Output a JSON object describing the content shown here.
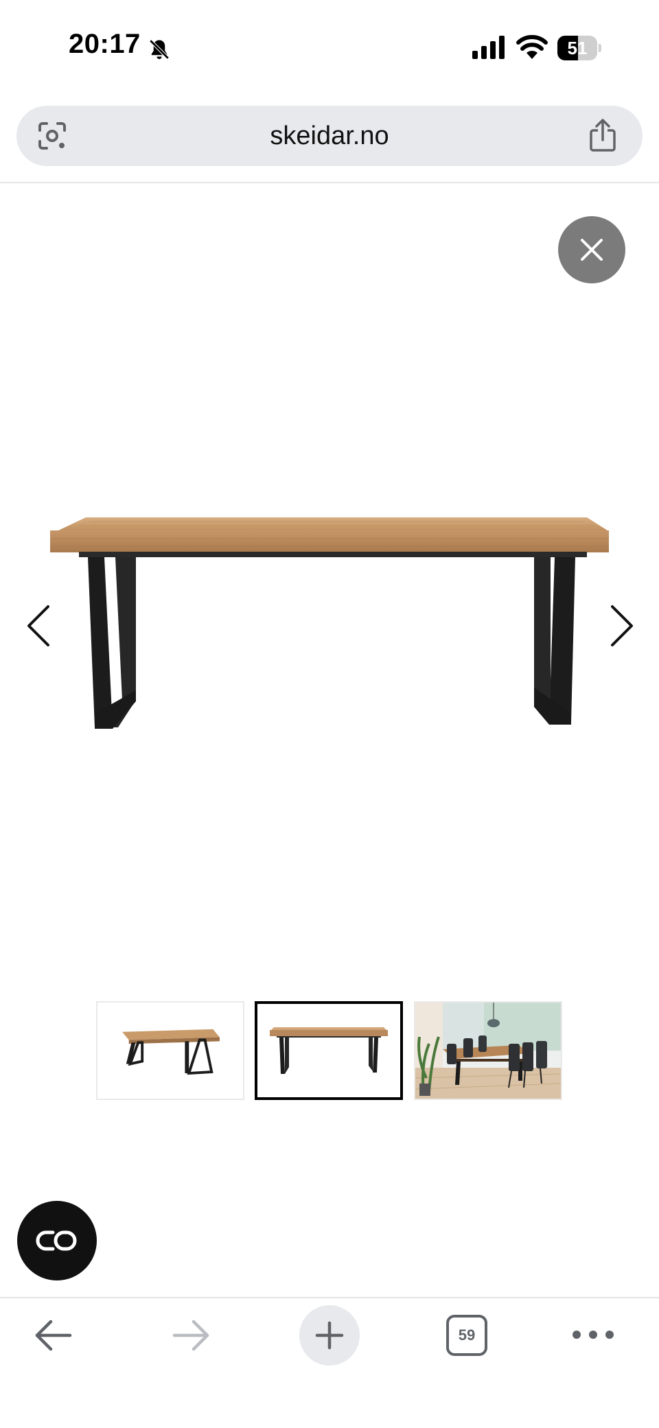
{
  "status_bar": {
    "time": "20:17",
    "battery_percent": 51,
    "battery_label": "51",
    "icons": [
      "bell-slash-icon",
      "cellular-signal-icon",
      "wifi-icon",
      "battery-icon"
    ]
  },
  "address_bar": {
    "url": "skeidar.no",
    "left_icon": "google-lens-icon",
    "right_icon": "share-icon"
  },
  "gallery": {
    "close_icon": "close-icon",
    "prev_icon": "chevron-left-icon",
    "next_icon": "chevron-right-icon",
    "main_image": "dining-table-front-view",
    "thumbnails": [
      {
        "name": "table-angled-view",
        "active": false
      },
      {
        "name": "table-front-view",
        "active": true
      },
      {
        "name": "dining-room-scene",
        "active": false
      }
    ]
  },
  "floating_button": {
    "icon": "link-icon"
  },
  "toolbar": {
    "tab_count": "59",
    "icons": [
      "back-arrow-icon",
      "forward-arrow-icon",
      "plus-icon",
      "tabs-icon",
      "more-dots-icon"
    ]
  },
  "colors": {
    "address_bar_bg": "#e8e9ed",
    "close_button_bg": "#7b7b7b",
    "toolbar_icon": "#5f6368",
    "wood": "#c99a6a",
    "metal": "#1c1c1c"
  }
}
